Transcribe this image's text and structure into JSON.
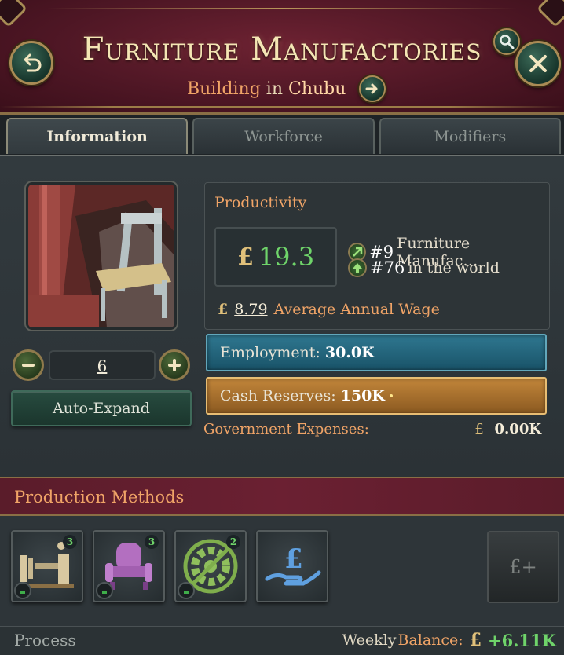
{
  "header": {
    "title": "Furniture Manufactories",
    "subtitle_type": "Building",
    "subtitle_in": "in",
    "subtitle_location": "Chubu",
    "icons": [
      "back-icon",
      "search-icon",
      "close-icon",
      "arrow-right-icon"
    ]
  },
  "tabs": [
    {
      "label": "Information",
      "active": true
    },
    {
      "label": "Workforce",
      "active": false
    },
    {
      "label": "Modifiers",
      "active": false
    }
  ],
  "building": {
    "level": "6",
    "auto_expand_label": "Auto-Expand"
  },
  "productivity": {
    "label": "Productivity",
    "currency": "£",
    "value": "19.3",
    "rank_local_num": "#9",
    "rank_local_text": "Furniture Manufac…",
    "rank_world_num": "#76",
    "rank_world_text": "in the world",
    "wage_value": "8.79",
    "wage_label": "Average Annual Wage"
  },
  "bars": {
    "employment_label": "Employment:",
    "employment_value": "30.0K",
    "cash_label": "Cash Reserves:",
    "cash_value": "150K"
  },
  "government": {
    "label": "Government Expenses:",
    "currency": "£",
    "value": "0.00K"
  },
  "production_methods": {
    "title": "Production Methods",
    "tiles": [
      {
        "icon": "lathe-machinery-icon",
        "count": "3"
      },
      {
        "icon": "armchair-icon",
        "count": "3"
      },
      {
        "icon": "no-automation-gear-icon",
        "count": "2"
      },
      {
        "icon": "pound-hand-ownership-icon",
        "count": ""
      }
    ],
    "add_label": "£+"
  },
  "footer": {
    "process_label": "Process",
    "weekly_label": "Weekly",
    "balance_label": "Balance:",
    "currency": "£",
    "balance_value": "+6.11K"
  },
  "colors": {
    "header_bg": "#4d1624",
    "title_gold": "#f4e6b4",
    "orange_label": "#f0a467",
    "positive_green": "#6fd46a",
    "employment_blue": "#2f7790",
    "cash_gold": "#c2863a"
  }
}
